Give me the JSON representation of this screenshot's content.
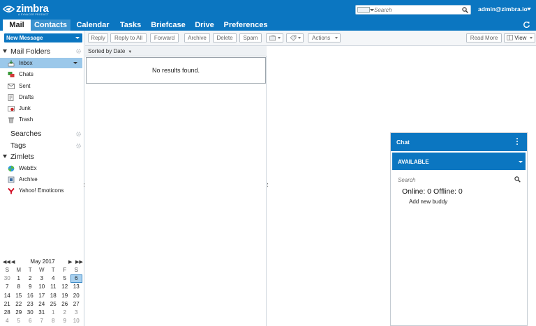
{
  "header": {
    "brand": "zimbra",
    "tagline": "A SYNACOR PRODUCT",
    "search_placeholder": "Search",
    "username": "admin@zimbra.io"
  },
  "tabs": [
    {
      "label": "Mail",
      "state": "active"
    },
    {
      "label": "Contacts",
      "state": "hover"
    },
    {
      "label": "Calendar",
      "state": "normal"
    },
    {
      "label": "Tasks",
      "state": "normal"
    },
    {
      "label": "Briefcase",
      "state": "normal"
    },
    {
      "label": "Drive",
      "state": "normal"
    },
    {
      "label": "Preferences",
      "state": "normal"
    }
  ],
  "sidebar": {
    "new_message": "New Message",
    "mail_folders": "Mail Folders",
    "folders": [
      {
        "label": "Inbox",
        "icon": "inbox-icon",
        "selected": true
      },
      {
        "label": "Chats",
        "icon": "chats-icon"
      },
      {
        "label": "Sent",
        "icon": "sent-icon"
      },
      {
        "label": "Drafts",
        "icon": "drafts-icon"
      },
      {
        "label": "Junk",
        "icon": "junk-icon"
      },
      {
        "label": "Trash",
        "icon": "trash-icon"
      }
    ],
    "searches": "Searches",
    "tags": "Tags",
    "zimlets": "Zimlets",
    "zimlet_items": [
      {
        "label": "WebEx",
        "icon": "webex-icon"
      },
      {
        "label": "Archive",
        "icon": "archive-icon"
      },
      {
        "label": "Yahoo! Emoticons",
        "icon": "yahoo-icon"
      }
    ]
  },
  "calendar": {
    "month": "May 2017",
    "days_of_week": [
      "S",
      "M",
      "T",
      "W",
      "T",
      "F",
      "S"
    ],
    "weeks": [
      [
        "30",
        "1",
        "2",
        "3",
        "4",
        "5",
        "6"
      ],
      [
        "7",
        "8",
        "9",
        "10",
        "11",
        "12",
        "13"
      ],
      [
        "14",
        "15",
        "16",
        "17",
        "18",
        "19",
        "20"
      ],
      [
        "21",
        "22",
        "23",
        "24",
        "25",
        "26",
        "27"
      ],
      [
        "28",
        "29",
        "30",
        "31",
        "1",
        "2",
        "3"
      ],
      [
        "4",
        "5",
        "6",
        "7",
        "8",
        "9",
        "10"
      ]
    ],
    "today": "6"
  },
  "toolbar": {
    "reply": "Reply",
    "reply_all": "Reply to All",
    "forward": "Forward",
    "archive": "Archive",
    "delete": "Delete",
    "spam": "Spam",
    "actions": "Actions",
    "read_more": "Read More",
    "view": "View"
  },
  "list": {
    "sort_label": "Sorted by Date",
    "empty_text": "No results found."
  },
  "chat": {
    "title": "Chat",
    "status": "AVAILABLE",
    "search_placeholder": "Search",
    "online_summary": "Online: 0 Offline: 0",
    "add_buddy": "Add new buddy"
  },
  "colors": {
    "brand_blue": "#0b76c1",
    "selected_folder": "#9bc8ea"
  }
}
